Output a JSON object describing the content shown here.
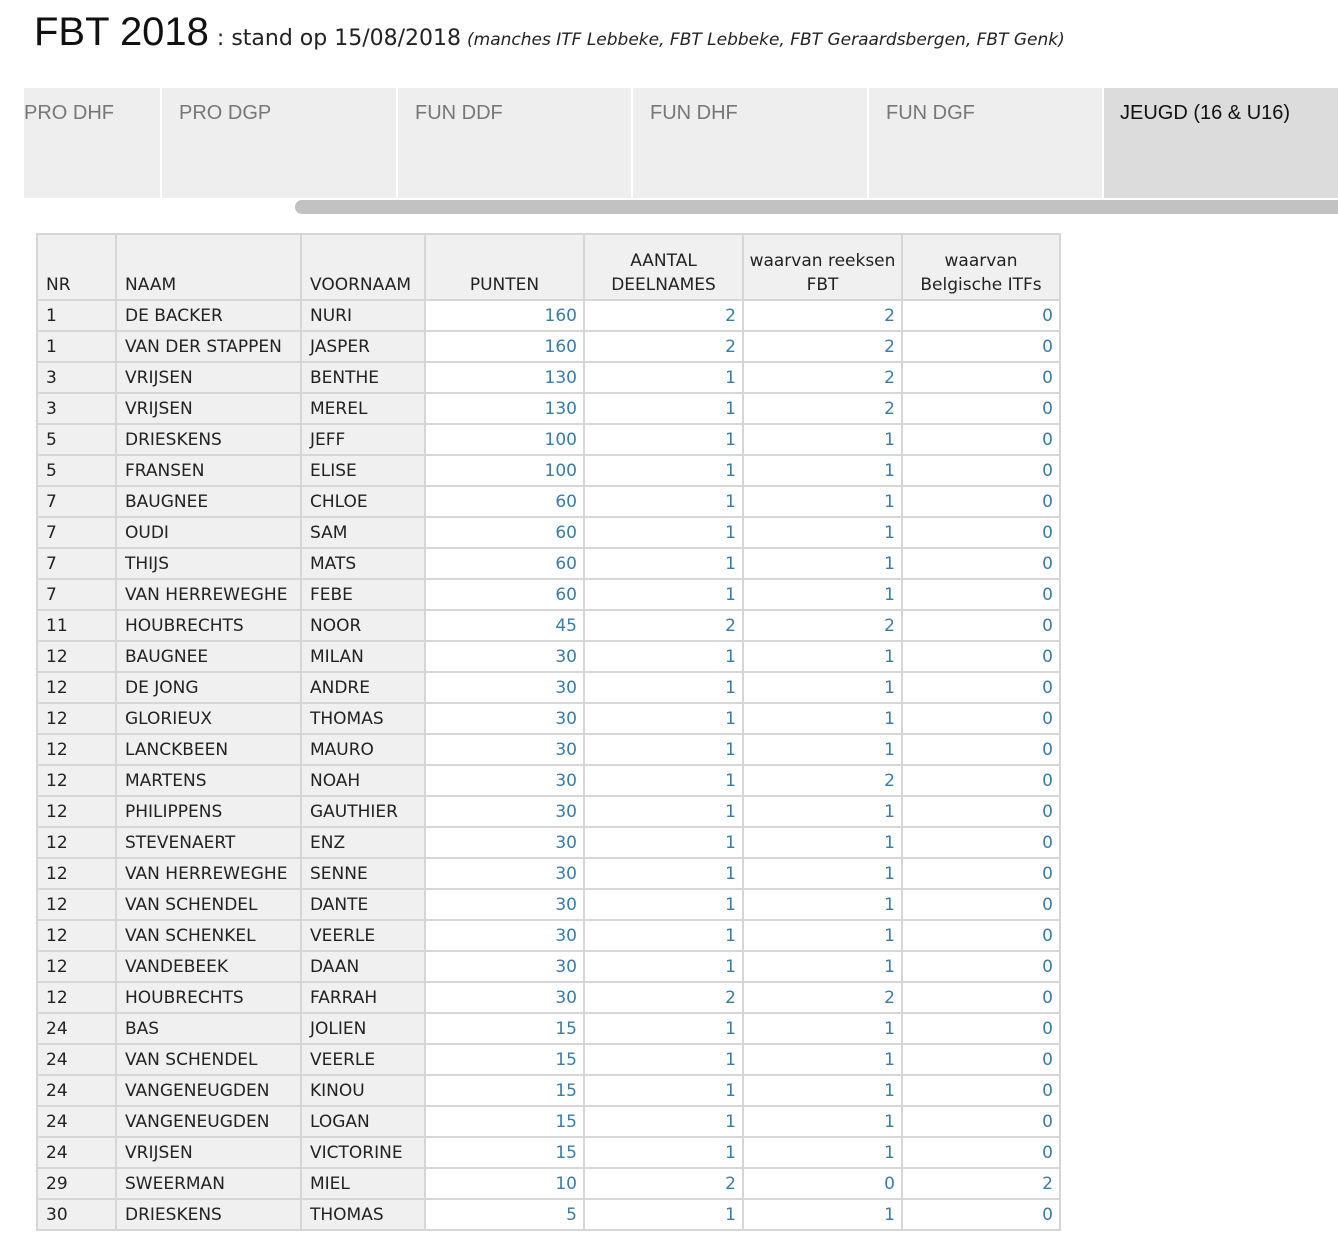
{
  "header": {
    "title": "FBT 2018",
    "subtitle": ": stand op 15/08/2018",
    "note": "(manches ITF Lebbeke, FBT Lebbeke, FBT Geraardsbergen, FBT Genk)"
  },
  "tabs": [
    {
      "label": "PRO DHF",
      "active": false
    },
    {
      "label": "PRO DGP",
      "active": false
    },
    {
      "label": "FUN DDF",
      "active": false
    },
    {
      "label": "FUN DHF",
      "active": false
    },
    {
      "label": "FUN DGF",
      "active": false
    },
    {
      "label": "JEUGD (16 & U16)",
      "active": true
    }
  ],
  "table": {
    "columns": [
      "NR",
      "NAAM",
      "VOORNAAM",
      "PUNTEN",
      "AANTAL DEELNAMES",
      "waarvan reeksen FBT",
      "waarvan Belgische ITFs"
    ],
    "rows": [
      [
        "1",
        "DE BACKER",
        "NURI",
        "160",
        "2",
        "2",
        "0"
      ],
      [
        "1",
        "VAN DER STAPPEN",
        "JASPER",
        "160",
        "2",
        "2",
        "0"
      ],
      [
        "3",
        "VRIJSEN",
        "BENTHE",
        "130",
        "1",
        "2",
        "0"
      ],
      [
        "3",
        "VRIJSEN",
        "MEREL",
        "130",
        "1",
        "2",
        "0"
      ],
      [
        "5",
        "DRIESKENS",
        "JEFF",
        "100",
        "1",
        "1",
        "0"
      ],
      [
        "5",
        "FRANSEN",
        "ELISE",
        "100",
        "1",
        "1",
        "0"
      ],
      [
        "7",
        "BAUGNEE",
        "CHLOE",
        "60",
        "1",
        "1",
        "0"
      ],
      [
        "7",
        "OUDI",
        "SAM",
        "60",
        "1",
        "1",
        "0"
      ],
      [
        "7",
        "THIJS",
        "MATS",
        "60",
        "1",
        "1",
        "0"
      ],
      [
        "7",
        "VAN HERREWEGHE",
        "FEBE",
        "60",
        "1",
        "1",
        "0"
      ],
      [
        "11",
        "HOUBRECHTS",
        "NOOR",
        "45",
        "2",
        "2",
        "0"
      ],
      [
        "12",
        "BAUGNEE",
        "MILAN",
        "30",
        "1",
        "1",
        "0"
      ],
      [
        "12",
        "DE JONG",
        "ANDRE",
        "30",
        "1",
        "1",
        "0"
      ],
      [
        "12",
        "GLORIEUX",
        "THOMAS",
        "30",
        "1",
        "1",
        "0"
      ],
      [
        "12",
        "LANCKBEEN",
        "MAURO",
        "30",
        "1",
        "1",
        "0"
      ],
      [
        "12",
        "MARTENS",
        "NOAH",
        "30",
        "1",
        "2",
        "0"
      ],
      [
        "12",
        "PHILIPPENS",
        "GAUTHIER",
        "30",
        "1",
        "1",
        "0"
      ],
      [
        "12",
        "STEVENAERT",
        "ENZ",
        "30",
        "1",
        "1",
        "0"
      ],
      [
        "12",
        "VAN HERREWEGHE",
        "SENNE",
        "30",
        "1",
        "1",
        "0"
      ],
      [
        "12",
        "VAN SCHENDEL",
        "DANTE",
        "30",
        "1",
        "1",
        "0"
      ],
      [
        "12",
        "VAN SCHENKEL",
        "VEERLE",
        "30",
        "1",
        "1",
        "0"
      ],
      [
        "12",
        "VANDEBEEK",
        "DAAN",
        "30",
        "1",
        "1",
        "0"
      ],
      [
        "12",
        "HOUBRECHTS",
        "FARRAH",
        "30",
        "2",
        "2",
        "0"
      ],
      [
        "24",
        "BAS",
        "JOLIEN",
        "15",
        "1",
        "1",
        "0"
      ],
      [
        "24",
        "VAN SCHENDEL",
        "VEERLE",
        "15",
        "1",
        "1",
        "0"
      ],
      [
        "24",
        "VANGENEUGDEN",
        "KINOU",
        "15",
        "1",
        "1",
        "0"
      ],
      [
        "24",
        "VANGENEUGDEN",
        "LOGAN",
        "15",
        "1",
        "1",
        "0"
      ],
      [
        "24",
        "VRIJSEN",
        "VICTORINE",
        "15",
        "1",
        "1",
        "0"
      ],
      [
        "29",
        "SWEERMAN",
        "MIEL",
        "10",
        "2",
        "0",
        "2"
      ],
      [
        "30",
        "DRIESKENS",
        "THOMAS",
        "5",
        "1",
        "1",
        "0"
      ]
    ]
  },
  "colors": {
    "number_text": "#3a7ca8",
    "header_bg": "#f0f0f0",
    "tab_bg": "#eeeeee",
    "tab_active_bg": "#dcdcdc",
    "grid": "#d6d6d6"
  }
}
